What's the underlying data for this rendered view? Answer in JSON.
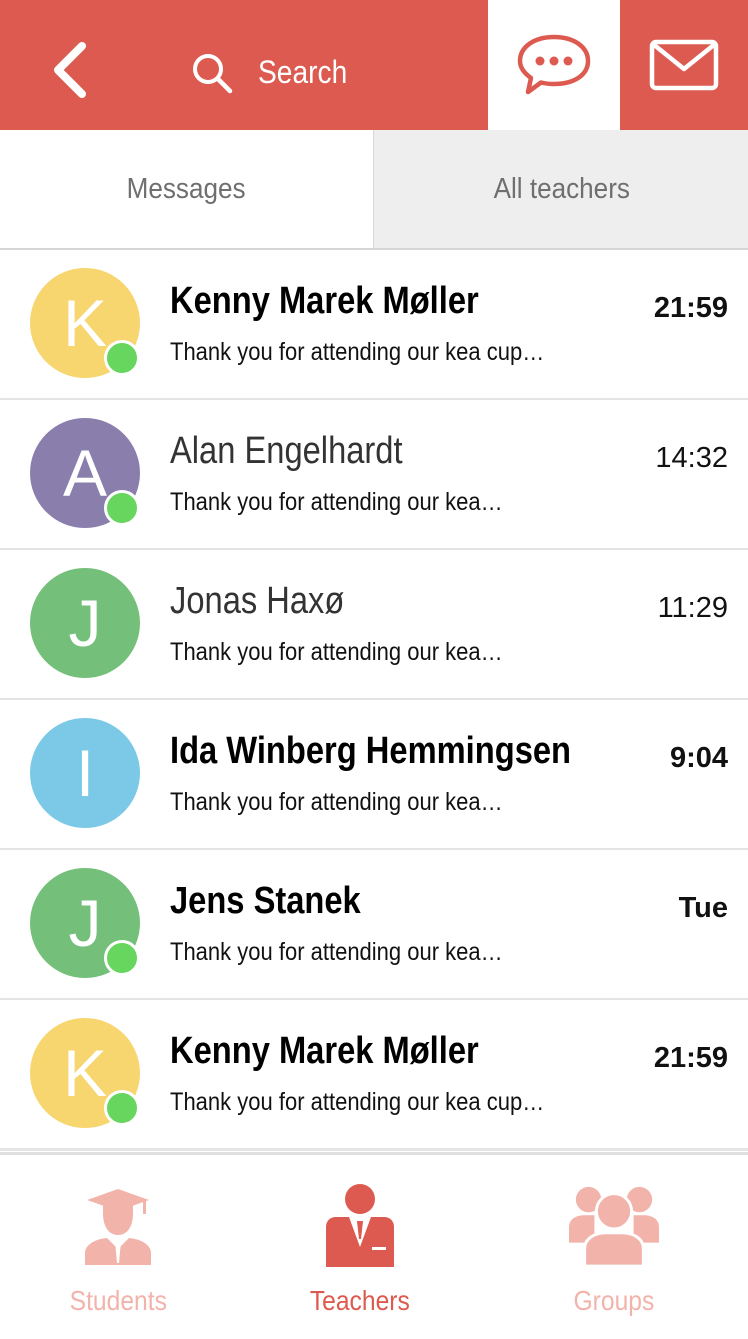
{
  "header": {
    "back_icon": "chevron-left-icon",
    "search_icon": "search-icon",
    "search_label": "Search",
    "chat_icon": "chat-bubble-icon",
    "mail_icon": "envelope-icon",
    "accent_color": "#dc5a4f"
  },
  "tabs": [
    {
      "label": "Messages",
      "active": true
    },
    {
      "label": "All teachers",
      "active": false
    }
  ],
  "conversations": [
    {
      "initial": "K",
      "name": "Kenny Marek Møller",
      "preview": "Thank you for attending our kea cup…",
      "time": "21:59",
      "unread": true,
      "online": true,
      "avatar_color": "#f7d56f"
    },
    {
      "initial": "A",
      "name": "Alan Engelhardt",
      "preview": "Thank you for attending our kea…",
      "time": "14:32",
      "unread": false,
      "online": true,
      "avatar_color": "#8a7ead"
    },
    {
      "initial": "J",
      "name": "Jonas Haxø",
      "preview": "Thank you for attending our kea…",
      "time": "11:29",
      "unread": false,
      "online": false,
      "avatar_color": "#74bf79"
    },
    {
      "initial": "I",
      "name": "Ida Winberg Hemmingsen",
      "preview": "Thank you for attending our kea…",
      "time": "9:04",
      "unread": true,
      "online": false,
      "avatar_color": "#7bc9e6"
    },
    {
      "initial": "J",
      "name": "Jens Stanek",
      "preview": "Thank you for attending our kea…",
      "time": "Tue",
      "unread": true,
      "online": true,
      "avatar_color": "#74bf79"
    },
    {
      "initial": "K",
      "name": "Kenny Marek Møller",
      "preview": "Thank you for attending our kea cup…",
      "time": "21:59",
      "unread": true,
      "online": true,
      "avatar_color": "#f7d56f"
    }
  ],
  "bottom_nav": [
    {
      "label": "Students",
      "icon": "graduate-icon",
      "active": false
    },
    {
      "label": "Teachers",
      "icon": "teacher-icon",
      "active": true
    },
    {
      "label": "Groups",
      "icon": "group-icon",
      "active": false
    }
  ]
}
